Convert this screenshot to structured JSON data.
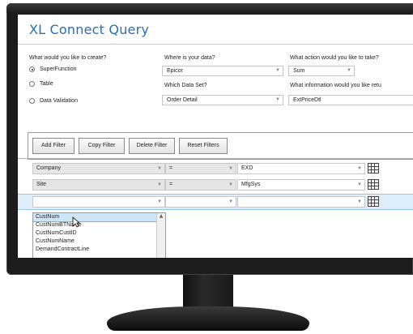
{
  "app": {
    "title": "XL Connect Query"
  },
  "create": {
    "question": "What would you like to create?",
    "options": [
      {
        "label": "SuperFunction",
        "selected": true
      },
      {
        "label": "Table",
        "selected": false
      },
      {
        "label": "Data Validation",
        "selected": false
      }
    ]
  },
  "source": {
    "question": "Where is your data?",
    "value": "Epicor",
    "dataset_question": "Which Data Set?",
    "dataset_value": "Order Detail"
  },
  "action": {
    "question": "What action would you like to take?",
    "value": "Sum",
    "info_question": "What information would you like retu",
    "info_value": "ExtPriceDtl"
  },
  "filter_buttons": [
    "Add Filter",
    "Copy Filter",
    "Delete Filter",
    "Reset Filters"
  ],
  "filters": [
    {
      "field": "Company",
      "operator": "=",
      "value": "EXD"
    },
    {
      "field": "Site",
      "operator": "=",
      "value": "MfgSys"
    },
    {
      "field": "",
      "operator": "",
      "value": ""
    }
  ],
  "dropdown_items": [
    {
      "label": "CustNum",
      "selected": true
    },
    {
      "label": "CustNumBTName",
      "selected": false
    },
    {
      "label": "CustNumCustID",
      "selected": false
    },
    {
      "label": "CustNumName",
      "selected": false
    },
    {
      "label": "DemandContractLine",
      "selected": false
    }
  ],
  "colors": {
    "title": "#2b6fb5",
    "selected_row": "#ddeefa",
    "selected_item": "#cde6f7"
  }
}
